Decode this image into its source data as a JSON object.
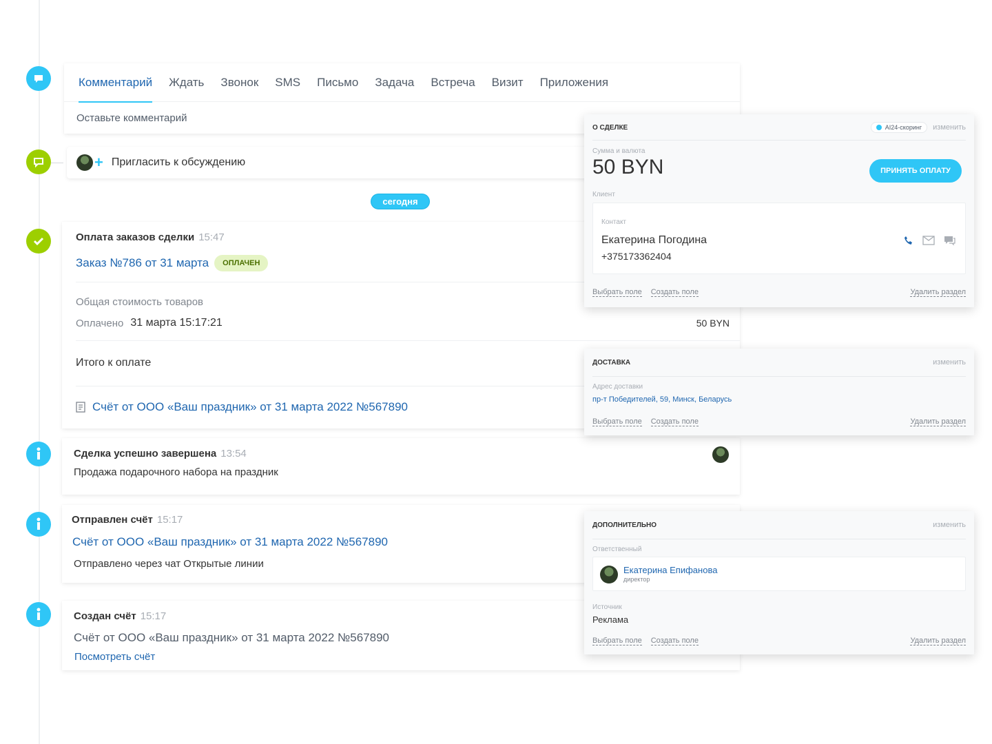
{
  "composer": {
    "tabs": [
      "Комментарий",
      "Ждать",
      "Звонок",
      "SMS",
      "Письмо",
      "Задача",
      "Встреча",
      "Визит",
      "Приложения"
    ],
    "placeholder": "Оставьте комментарий"
  },
  "invite": {
    "label": "Пригласить к обсуждению"
  },
  "today_label": "сегодня",
  "payment": {
    "title": "Оплата заказов сделки",
    "time": "15:47",
    "order_link": "Заказ №786 от 31 марта",
    "status": "оплачен",
    "total_label": "Общая стоимость товаров",
    "paid_label": "Оплачено",
    "paid_date": "31 марта 15:17:21",
    "paid_amount": "50 BYN",
    "due_label": "Итого к оплате",
    "invoice_link": "Счёт от ООО «Ваш праздник» от 31 марта 2022 №567890"
  },
  "completed": {
    "title": "Сделка успешно завершена",
    "time": "13:54",
    "text": "Продажа подарочного набора на праздник"
  },
  "sent": {
    "title": "Отправлен счёт",
    "time": "15:17",
    "link": "Счёт от ООО «Ваш праздник» от 31 марта 2022 №567890",
    "text": "Отправлено через чат Открытые линии"
  },
  "created": {
    "title": "Создан счёт",
    "time": "15:17",
    "text": "Счёт от ООО «Ваш праздник» от 31 марта 2022 №567890",
    "link": "Посмотреть счёт"
  },
  "deal_panel": {
    "title": "О сделке",
    "scoring": "AI24-скоринг",
    "edit": "изменить",
    "amount_label": "Сумма и валюта",
    "amount": "50 BYN",
    "pay_button": "Принять оплату",
    "client_label": "Клиент",
    "contact_label": "Контакт",
    "contact_name": "Екатерина Погодина",
    "contact_phone": "+375173362404",
    "select_field": "Выбрать поле",
    "create_field": "Создать поле",
    "delete_section": "Удалить раздел"
  },
  "delivery_panel": {
    "title": "Доставка",
    "edit": "изменить",
    "address_label": "Адрес доставки",
    "address": "пр-т Победителей, 59, Минск, Беларусь",
    "select_field": "Выбрать поле",
    "create_field": "Создать поле",
    "delete_section": "Удалить раздел"
  },
  "extra_panel": {
    "title": "Дополнительно",
    "edit": "изменить",
    "responsible_label": "Ответственный",
    "responsible_name": "Екатерина Епифанова",
    "responsible_role": "директор",
    "source_label": "Источник",
    "source": "Реклама",
    "select_field": "Выбрать поле",
    "create_field": "Создать поле",
    "delete_section": "Удалить раздел"
  }
}
